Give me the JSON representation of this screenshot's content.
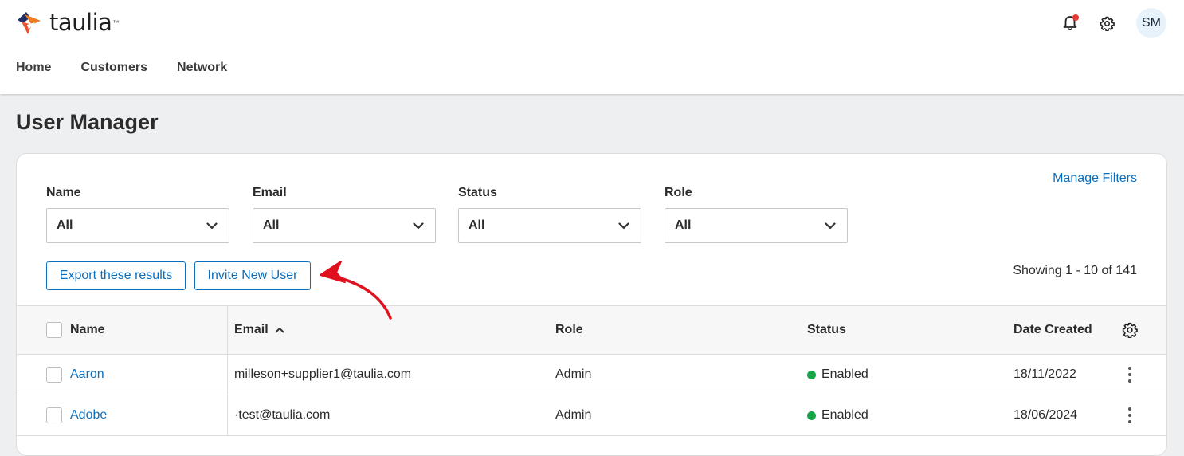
{
  "app": {
    "brand": "taulia",
    "brand_mark": "™"
  },
  "header": {
    "avatar_initials": "SM",
    "has_notification": true
  },
  "nav": {
    "items": [
      {
        "label": "Home"
      },
      {
        "label": "Customers"
      },
      {
        "label": "Network"
      }
    ]
  },
  "page": {
    "title": "User Manager"
  },
  "filters": {
    "manage_label": "Manage Filters",
    "items": [
      {
        "label": "Name",
        "value": "All"
      },
      {
        "label": "Email",
        "value": "All"
      },
      {
        "label": "Status",
        "value": "All"
      },
      {
        "label": "Role",
        "value": "All"
      }
    ]
  },
  "actions": {
    "export_label": "Export these results",
    "invite_label": "Invite New User"
  },
  "results": {
    "summary": "Showing 1 - 10 of 141"
  },
  "table": {
    "columns": {
      "name": "Name",
      "email": "Email",
      "role": "Role",
      "status": "Status",
      "date_created": "Date Created"
    },
    "sort": {
      "column": "email",
      "direction": "ascending"
    },
    "rows": [
      {
        "name": "Aaron",
        "email": "milleson+supplier1@taulia.com",
        "role": "Admin",
        "status": "Enabled",
        "date_created": "18/11/2022"
      },
      {
        "name": "Adobe",
        "email": "·test@taulia.com",
        "role": "Admin",
        "status": "Enabled",
        "date_created": "18/06/2024"
      }
    ]
  },
  "colors": {
    "brand_blue": "#0a6ebd",
    "status_enabled": "#17a34a",
    "annotation_arrow": "#e0101e",
    "notification": "#e53935"
  },
  "annotation": {
    "type": "red-arrow",
    "points_to": "invite-new-user-button"
  }
}
